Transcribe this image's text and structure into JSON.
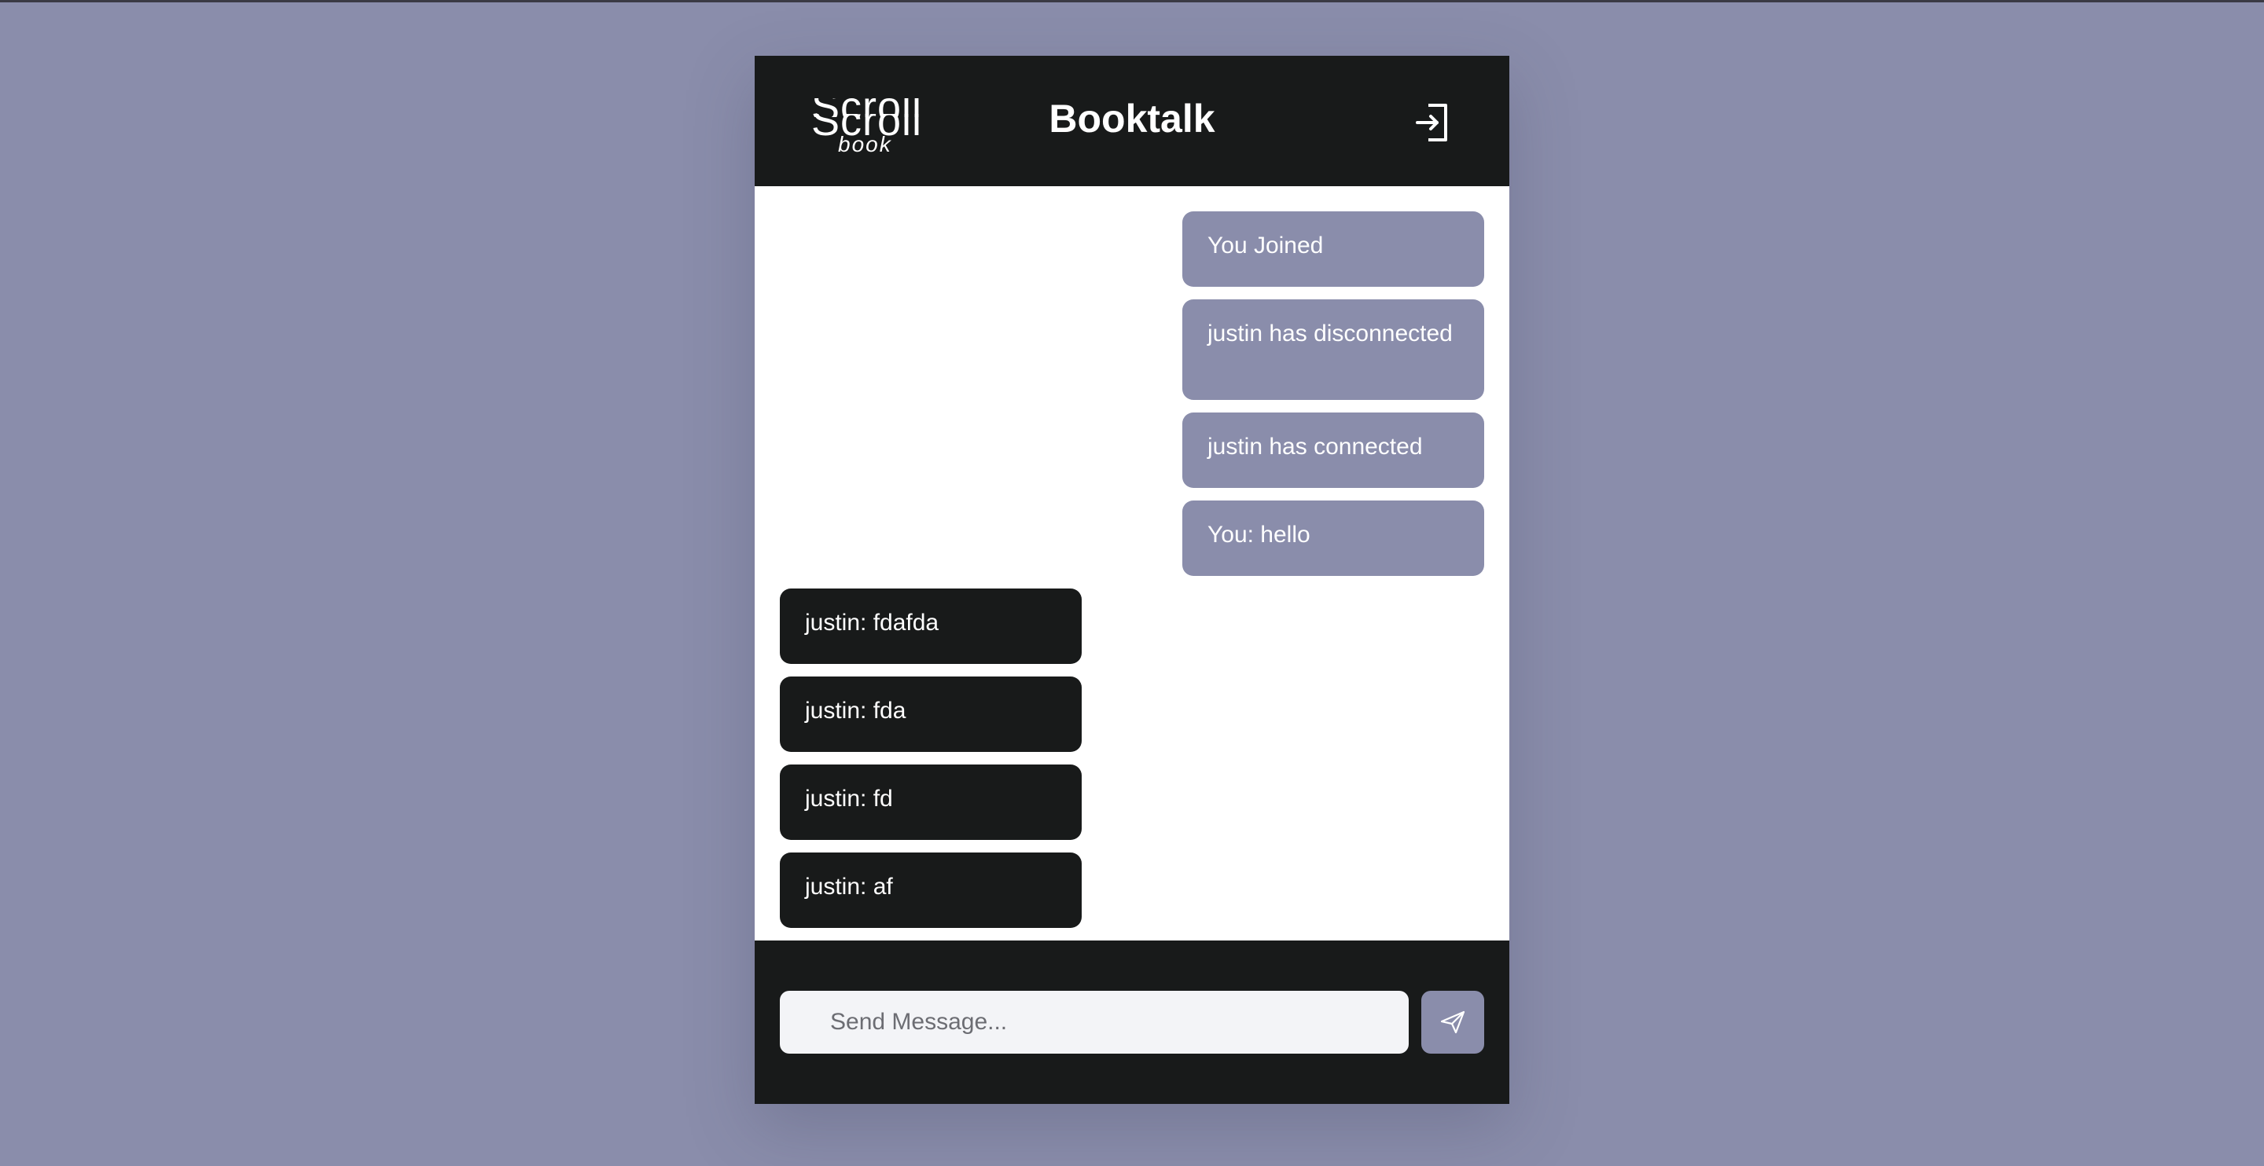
{
  "app": {
    "logo_top": "Scroll",
    "logo_bottom": "Scroll",
    "logo_sub": "book",
    "title": "Booktalk",
    "exit_icon": "exit-door-icon"
  },
  "messages": [
    {
      "text": "You Joined",
      "direction": "out"
    },
    {
      "text": "justin has disconnected",
      "direction": "out"
    },
    {
      "text": "justin has connected",
      "direction": "out"
    },
    {
      "text": "You: hello",
      "direction": "out"
    },
    {
      "text": "justin: fdafda",
      "direction": "in"
    },
    {
      "text": "justin: fda",
      "direction": "in"
    },
    {
      "text": "justin: fd",
      "direction": "in"
    },
    {
      "text": "justin: af",
      "direction": "in"
    }
  ],
  "composer": {
    "placeholder": "Send Message...",
    "value": "",
    "send_icon": "paper-plane-icon"
  },
  "colors": {
    "background": "#8a8dab",
    "panel_dark": "#181a1a",
    "bubble_outgoing": "#8a8dab",
    "bubble_incoming": "#181a1a",
    "input_bg": "#f3f4f7"
  }
}
